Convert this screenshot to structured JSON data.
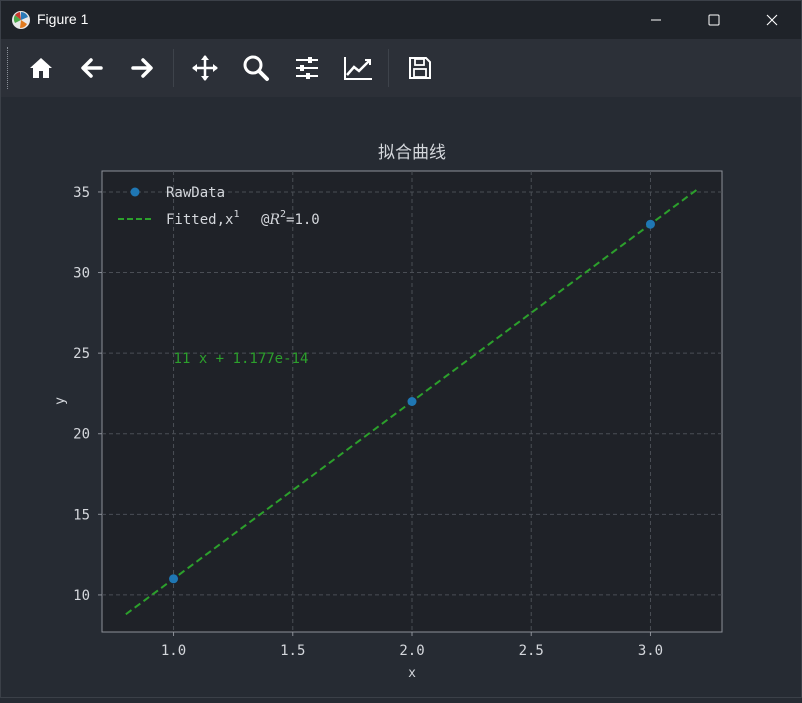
{
  "window": {
    "title": "Figure 1"
  },
  "toolbar": {
    "buttons": [
      {
        "icon": "home-icon",
        "name": "home-button"
      },
      {
        "icon": "arrow-left-icon",
        "name": "back-button"
      },
      {
        "icon": "arrow-right-icon",
        "name": "forward-button"
      },
      {
        "icon": "move-icon",
        "name": "pan-button"
      },
      {
        "icon": "search-icon",
        "name": "zoom-button"
      },
      {
        "icon": "sliders-icon",
        "name": "configure-subplots-button"
      },
      {
        "icon": "chart-line-icon",
        "name": "edit-axis-button"
      },
      {
        "icon": "save-icon",
        "name": "save-button"
      }
    ]
  },
  "colors": {
    "background": "#262b33",
    "axes_face": "#1f2228",
    "raw": "#1f77b4",
    "fit": "#2ca02c",
    "text": "#d4d7dc",
    "grid": "#4a4e55"
  },
  "chart_data": {
    "type": "line",
    "title": "拟合曲线",
    "xlabel": "x",
    "ylabel": "y",
    "xlim": [
      0.7,
      3.3
    ],
    "ylim": [
      7.7,
      36.3
    ],
    "xticks": [
      1.0,
      1.5,
      2.0,
      2.5,
      3.0
    ],
    "xtick_labels": [
      "1.0",
      "1.5",
      "2.0",
      "2.5",
      "3.0"
    ],
    "yticks": [
      10,
      15,
      20,
      25,
      30,
      35
    ],
    "ytick_labels": [
      "10",
      "15",
      "20",
      "25",
      "30",
      "35"
    ],
    "grid": true,
    "legend_position": "top-left",
    "series": [
      {
        "name": "RawData",
        "kind": "scatter",
        "x": [
          1,
          2,
          3
        ],
        "y": [
          11,
          22,
          33
        ]
      },
      {
        "name": "Fitted",
        "kind": "dashed-line",
        "x": [
          0.8,
          3.2
        ],
        "y": [
          8.8,
          35.2
        ]
      }
    ],
    "legend": {
      "raw_label": "RawData",
      "fit_label_prefix": "Fitted,x",
      "fit_label_sup": "1",
      "fit_label_at": "@",
      "fit_label_r": "R",
      "fit_label_r_sup": "2",
      "fit_label_suffix": "=1.0"
    },
    "annotation": {
      "text": "11 x + 1.177e-14",
      "x": 1.0,
      "y": 24.4
    }
  }
}
